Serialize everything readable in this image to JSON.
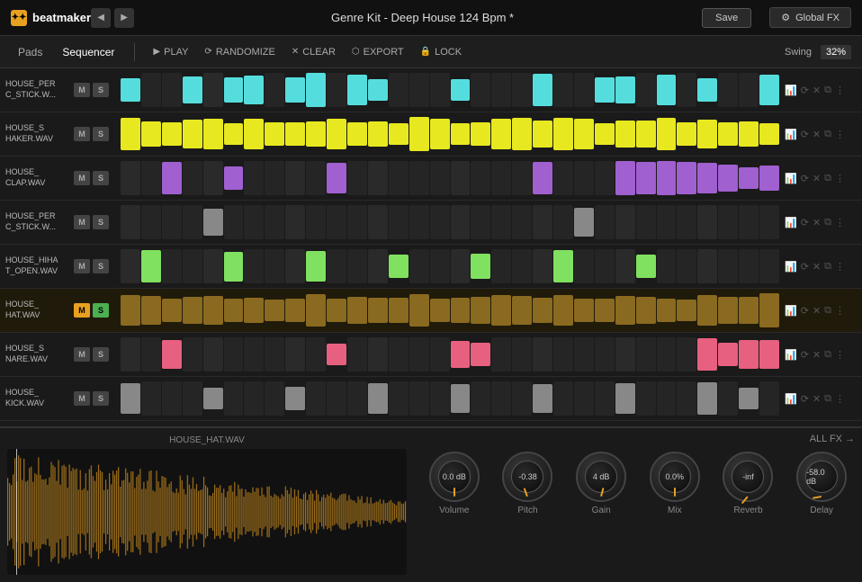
{
  "app": {
    "logo": "beatmaker",
    "logo_icon": "●●"
  },
  "header": {
    "title": "Genre Kit - Deep House 124 Bpm *",
    "save_label": "Save",
    "global_fx_label": "Global FX",
    "nav_back": "◀",
    "nav_forward": "▶"
  },
  "toolbar": {
    "pads_label": "Pads",
    "sequencer_label": "Sequencer",
    "play_label": "PLAY",
    "randomize_label": "RANDOMIZE",
    "clear_label": "CLEAR",
    "export_label": "EXPORT",
    "lock_label": "LOCK",
    "swing_label": "Swing",
    "swing_value": "32%"
  },
  "tracks": [
    {
      "id": 0,
      "name": "HOUSE_PER\nC_STICK.W...",
      "m_active": false,
      "s_active": false,
      "color": "#5dd",
      "notes": [
        1,
        0,
        0,
        1,
        0,
        1,
        1,
        0,
        1,
        1,
        0,
        1,
        1,
        0,
        0,
        0,
        1,
        0,
        0,
        0,
        1,
        0,
        0,
        1,
        1,
        0,
        1,
        0,
        1,
        0,
        0,
        1
      ]
    },
    {
      "id": 1,
      "name": "HOUSE_S\nHAKER.WAV",
      "m_active": false,
      "s_active": false,
      "color": "#e8e820",
      "notes": [
        1,
        1,
        1,
        1,
        1,
        1,
        1,
        1,
        1,
        1,
        1,
        1,
        1,
        1,
        1,
        1,
        1,
        1,
        1,
        1,
        1,
        1,
        1,
        1,
        1,
        1,
        1,
        1,
        1,
        1,
        1,
        1
      ]
    },
    {
      "id": 2,
      "name": "HOUSE_\nCLAP.WAV",
      "m_active": false,
      "s_active": false,
      "color": "#a060d0",
      "notes": [
        0,
        0,
        1,
        0,
        0,
        1,
        0,
        0,
        0,
        0,
        1,
        0,
        0,
        0,
        0,
        0,
        0,
        0,
        0,
        0,
        1,
        0,
        0,
        0,
        1,
        1,
        1,
        1,
        1,
        1,
        1,
        1
      ]
    },
    {
      "id": 3,
      "name": "HOUSE_PER\nC_STICK.W...",
      "m_active": false,
      "s_active": false,
      "color": "#999",
      "notes": [
        0,
        0,
        0,
        0,
        1,
        0,
        0,
        0,
        0,
        0,
        0,
        0,
        0,
        0,
        0,
        0,
        0,
        0,
        0,
        0,
        0,
        0,
        1,
        0,
        0,
        0,
        0,
        0,
        0,
        0,
        0,
        0
      ]
    },
    {
      "id": 4,
      "name": "HOUSE_HIHA\nT_OPEN.WAV",
      "m_active": false,
      "s_active": false,
      "color": "#80e060",
      "notes": [
        0,
        1,
        0,
        0,
        0,
        1,
        0,
        0,
        0,
        1,
        0,
        0,
        0,
        1,
        0,
        0,
        0,
        1,
        0,
        0,
        0,
        1,
        0,
        0,
        0,
        1,
        0,
        0,
        0,
        0,
        0,
        0
      ]
    },
    {
      "id": 5,
      "name": "HOUSE_\nHAT.WAV",
      "m_active": true,
      "s_active": true,
      "color": "#8a6a20",
      "notes": [
        1,
        1,
        1,
        1,
        1,
        1,
        1,
        1,
        1,
        1,
        1,
        1,
        1,
        1,
        1,
        1,
        1,
        1,
        1,
        1,
        1,
        1,
        1,
        1,
        1,
        1,
        1,
        1,
        1,
        1,
        1,
        1
      ]
    },
    {
      "id": 6,
      "name": "HOUSE_S\nNARE.WAV",
      "m_active": false,
      "s_active": false,
      "color": "#e86080",
      "notes": [
        0,
        0,
        1,
        0,
        0,
        0,
        0,
        0,
        0,
        0,
        1,
        0,
        0,
        0,
        0,
        0,
        1,
        1,
        0,
        0,
        0,
        0,
        0,
        0,
        0,
        0,
        0,
        0,
        1,
        1,
        1,
        1
      ]
    },
    {
      "id": 7,
      "name": "HOUSE_\nKICK.WAV",
      "m_active": false,
      "s_active": false,
      "color": "#999",
      "notes": [
        1,
        0,
        0,
        0,
        1,
        0,
        0,
        0,
        1,
        0,
        0,
        0,
        1,
        0,
        0,
        0,
        1,
        0,
        0,
        0,
        1,
        0,
        0,
        0,
        1,
        0,
        0,
        0,
        1,
        0,
        1,
        0
      ]
    }
  ],
  "bottom": {
    "waveform_label": "HOUSE_HAT.WAV",
    "all_fx_label": "ALL FX",
    "knobs": [
      {
        "id": "volume",
        "label": "Volume",
        "value": "0.0 dB",
        "angle": 0
      },
      {
        "id": "pitch",
        "label": "Pitch",
        "value": "-0.38",
        "angle": -20
      },
      {
        "id": "gain",
        "label": "Gain",
        "value": "4 dB",
        "angle": 15
      },
      {
        "id": "mix",
        "label": "Mix",
        "value": "0.0%",
        "angle": 0
      },
      {
        "id": "reverb",
        "label": "Reverb",
        "value": "-inf",
        "angle": -140
      },
      {
        "id": "delay",
        "label": "Delay",
        "value": "-58.0 dB",
        "angle": -100
      }
    ]
  }
}
